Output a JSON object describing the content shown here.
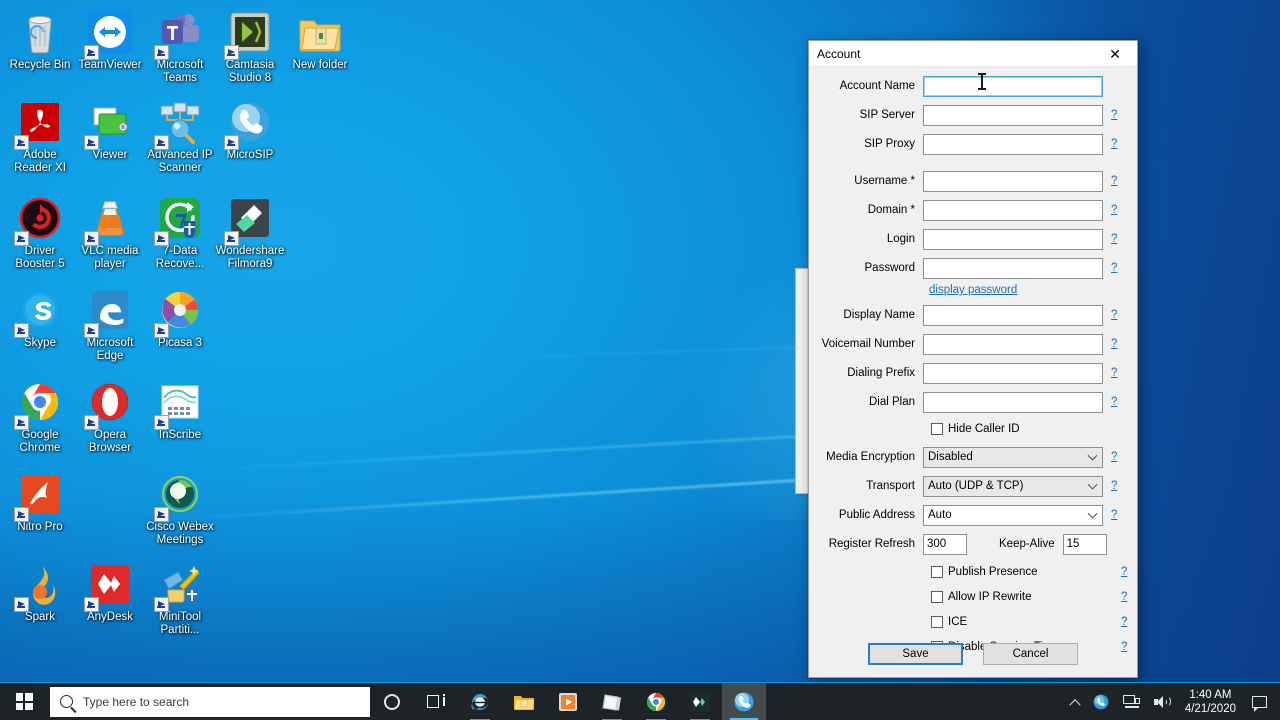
{
  "desktop": {
    "icons": [
      {
        "label": "Recycle Bin",
        "icon": "recycle-bin-icon",
        "shortcut": false,
        "col": 0,
        "row": 0
      },
      {
        "label": "TeamViewer",
        "icon": "teamviewer-icon",
        "shortcut": true,
        "col": 1,
        "row": 0
      },
      {
        "label": "Microsoft\nTeams",
        "icon": "microsoft-teams-icon",
        "shortcut": true,
        "col": 2,
        "row": 0
      },
      {
        "label": "Camtasia\nStudio 8",
        "icon": "camtasia-studio-icon",
        "shortcut": true,
        "col": 3,
        "row": 0
      },
      {
        "label": "New folder",
        "icon": "folder-icon",
        "shortcut": false,
        "col": 4,
        "row": 0
      },
      {
        "label": "Adobe\nReader XI",
        "icon": "adobe-reader-icon",
        "shortcut": true,
        "col": 0,
        "row": 1
      },
      {
        "label": "Viewer",
        "icon": "viewer-icon",
        "shortcut": true,
        "col": 1,
        "row": 1
      },
      {
        "label": "Advanced IP\nScanner",
        "icon": "advanced-ip-scanner-icon",
        "shortcut": true,
        "col": 2,
        "row": 1
      },
      {
        "label": "MicroSIP",
        "icon": "microsip-icon",
        "shortcut": true,
        "col": 3,
        "row": 1
      },
      {
        "label": "Driver\nBooster 5",
        "icon": "driver-booster-icon",
        "shortcut": true,
        "col": 0,
        "row": 2
      },
      {
        "label": "VLC media\nplayer",
        "icon": "vlc-media-player-icon",
        "shortcut": true,
        "col": 1,
        "row": 2
      },
      {
        "label": "7-Data\nRecove...",
        "icon": "seven-data-recovery-icon",
        "shortcut": true,
        "col": 2,
        "row": 2
      },
      {
        "label": "Wondershare\nFilmora9",
        "icon": "filmora-icon",
        "shortcut": true,
        "col": 3,
        "row": 2
      },
      {
        "label": "Skype",
        "icon": "skype-icon",
        "shortcut": true,
        "col": 0,
        "row": 3
      },
      {
        "label": "Microsoft\nEdge",
        "icon": "microsoft-edge-icon",
        "shortcut": true,
        "col": 1,
        "row": 3
      },
      {
        "label": "Picasa 3",
        "icon": "picasa-icon",
        "shortcut": true,
        "col": 2,
        "row": 3
      },
      {
        "label": "Google\nChrome",
        "icon": "google-chrome-icon",
        "shortcut": true,
        "col": 0,
        "row": 4
      },
      {
        "label": "Opera\nBrowser",
        "icon": "opera-browser-icon",
        "shortcut": true,
        "col": 1,
        "row": 4
      },
      {
        "label": "InScribe",
        "icon": "inscribe-icon",
        "shortcut": true,
        "col": 2,
        "row": 4
      },
      {
        "label": "Nitro Pro",
        "icon": "nitro-pro-icon",
        "shortcut": true,
        "col": 0,
        "row": 5
      },
      {
        "label": "Cisco Webex\nMeetings",
        "icon": "cisco-webex-icon",
        "shortcut": true,
        "col": 2,
        "row": 5
      },
      {
        "label": "Spark",
        "icon": "spark-icon",
        "shortcut": true,
        "col": 0,
        "row": 6
      },
      {
        "label": "AnyDesk",
        "icon": "anydesk-icon",
        "shortcut": true,
        "col": 1,
        "row": 6
      },
      {
        "label": "MiniTool\nPartiti...",
        "icon": "minitool-partition-icon",
        "shortcut": true,
        "col": 2,
        "row": 6
      }
    ]
  },
  "dialog": {
    "title": "Account",
    "close_label": "✕",
    "help_label": "?",
    "fields": [
      {
        "label": "Account Name",
        "value": "",
        "help": false,
        "focused": true
      },
      {
        "label": "SIP Server",
        "value": "",
        "help": true,
        "focused": false
      },
      {
        "label": "SIP Proxy",
        "value": "",
        "help": true,
        "focused": false
      },
      {
        "label": "Username *",
        "value": "",
        "help": true,
        "focused": false
      },
      {
        "label": "Domain *",
        "value": "",
        "help": true,
        "focused": false
      },
      {
        "label": "Login",
        "value": "",
        "help": true,
        "focused": false
      },
      {
        "label": "Password",
        "value": "",
        "help": true,
        "focused": false
      }
    ],
    "display_password_link": "display password",
    "fields2": [
      {
        "label": "Display Name",
        "value": "",
        "help": true,
        "focused": false
      },
      {
        "label": "Voicemail Number",
        "value": "",
        "help": true,
        "focused": false
      },
      {
        "label": "Dialing Prefix",
        "value": "",
        "help": true,
        "focused": false
      },
      {
        "label": "Dial Plan",
        "value": "",
        "help": true,
        "focused": false
      }
    ],
    "hide_caller_id": {
      "label": "Hide Caller ID",
      "checked": false
    },
    "selects": [
      {
        "label": "Media Encryption",
        "value": "Disabled",
        "disabled": true,
        "help": true
      },
      {
        "label": "Transport",
        "value": "Auto (UDP & TCP)",
        "disabled": true,
        "help": true
      },
      {
        "label": "Public Address",
        "value": "Auto",
        "disabled": false,
        "help": true
      }
    ],
    "register_refresh": {
      "label": "Register Refresh",
      "value": "300"
    },
    "keep_alive": {
      "label": "Keep-Alive",
      "value": "15"
    },
    "checkboxes": [
      {
        "label": "Publish Presence",
        "checked": false,
        "help": true
      },
      {
        "label": "Allow IP Rewrite",
        "checked": false,
        "help": true
      },
      {
        "label": "ICE",
        "checked": false,
        "help": true
      },
      {
        "label": "Disable Session Timers",
        "checked": false,
        "help": true
      }
    ],
    "buttons": {
      "save": "Save",
      "cancel": "Cancel"
    }
  },
  "taskbar": {
    "search_placeholder": "Type here to search",
    "items": [
      {
        "name": "cortana-button",
        "icon": "cortana-icon"
      },
      {
        "name": "task-view-button",
        "icon": "task-view-icon"
      },
      {
        "name": "internet-explorer-button",
        "icon": "internet-explorer-icon",
        "running": true
      },
      {
        "name": "file-explorer-button",
        "icon": "file-explorer-icon"
      },
      {
        "name": "media-player-button",
        "icon": "media-player-icon"
      },
      {
        "name": "sticky-notes-button",
        "icon": "sticky-notes-icon",
        "running": true
      },
      {
        "name": "google-chrome-button",
        "icon": "google-chrome-icon",
        "running": true
      },
      {
        "name": "anydesk-button",
        "icon": "anydesk-icon",
        "running": true
      },
      {
        "name": "microsip-button",
        "icon": "microsip-icon",
        "active": true
      }
    ],
    "tray": {
      "time": "1:40 AM",
      "date": "4/21/2020"
    }
  },
  "colors": {
    "accent": "#0078d7",
    "link": "#1d6fb8",
    "dialog_bg": "#f0f0f0",
    "taskbar": "#1d2327",
    "desktop_blue": "#0d8fd9"
  }
}
